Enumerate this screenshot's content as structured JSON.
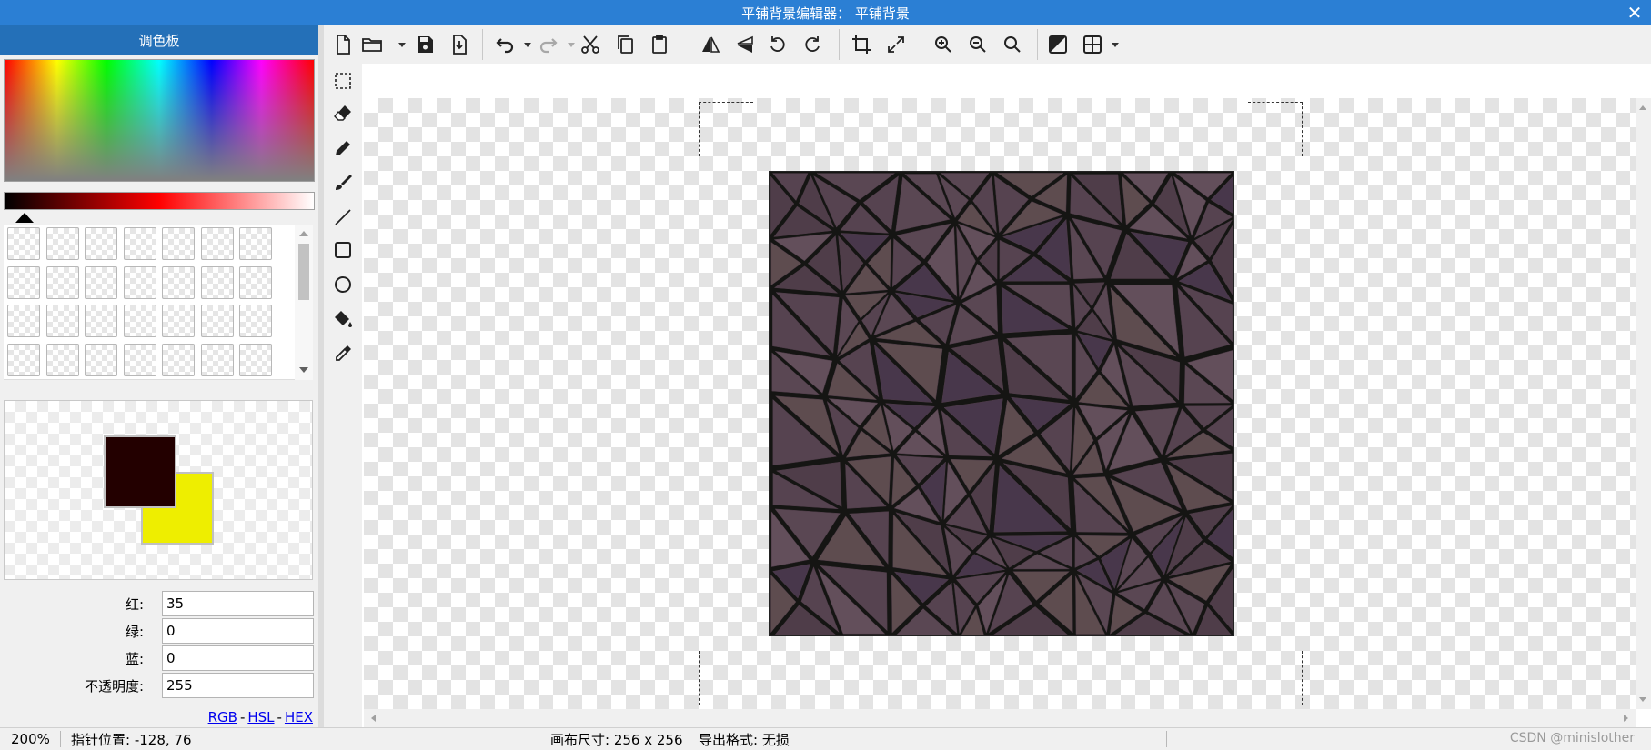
{
  "window": {
    "title": "平铺背景编辑器： 平铺背景",
    "close_glyph": "✕"
  },
  "palette": {
    "header": "调色板",
    "primary_color": "#230000",
    "secondary_color": "#eeee00",
    "fields": [
      {
        "label": "红:",
        "value": "35"
      },
      {
        "label": "绿:",
        "value": "0"
      },
      {
        "label": "蓝:",
        "value": "0"
      },
      {
        "label": "不透明度:",
        "value": "255"
      }
    ],
    "modes": {
      "rgb": "RGB",
      "hsl": "HSL",
      "hex": "HEX",
      "separator": "-"
    }
  },
  "toolbar": {
    "icons": [
      "new-file-icon",
      "open-folder-icon",
      "save-icon",
      "export-icon",
      "undo-icon",
      "redo-icon",
      "cut-icon",
      "copy-icon",
      "paste-icon",
      "flip-horizontal-icon",
      "flip-vertical-icon",
      "rotate-left-icon",
      "rotate-right-icon",
      "crop-icon",
      "resize-icon",
      "zoom-in-icon",
      "zoom-out-icon",
      "zoom-actual-icon",
      "invert-icon",
      "grid-icon"
    ]
  },
  "tools": [
    "select-rect-icon",
    "eraser-icon",
    "pencil-icon",
    "brush-icon",
    "line-icon",
    "rectangle-icon",
    "ellipse-icon",
    "fill-bucket-icon",
    "eyedropper-icon"
  ],
  "canvas": {
    "texture_base_color": "#4e3c48",
    "crack_color": "#151513"
  },
  "status": {
    "zoom": "200%",
    "pointer": "指针位置: -128, 76",
    "canvas_size": "画布尺寸: 256 x 256",
    "export_format": "导出格式: 无损"
  },
  "watermark": "CSDN @minislother"
}
